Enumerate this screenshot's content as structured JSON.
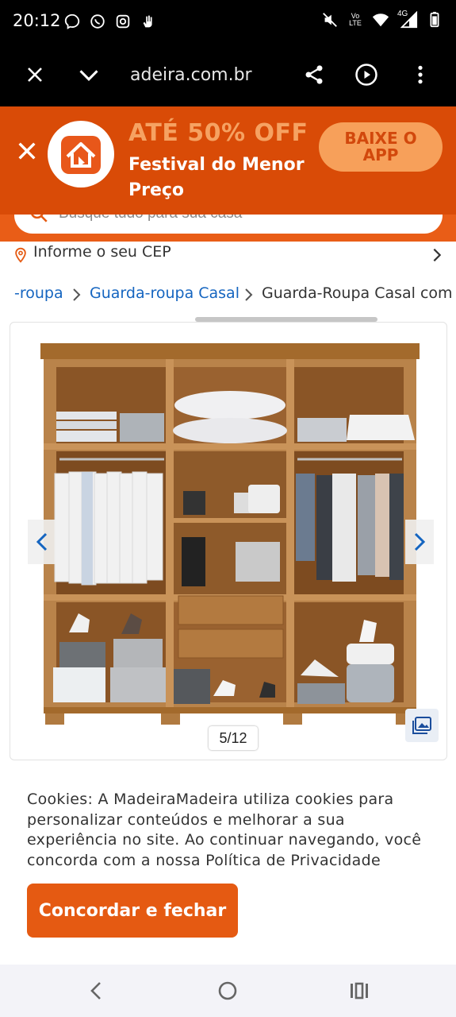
{
  "status_bar": {
    "time": "20:12",
    "left_icons": [
      "messenger-icon",
      "whatsapp-icon",
      "instagram-icon",
      "hand-icon"
    ],
    "right_icons": [
      "mute-icon",
      "volte-icon",
      "wifi-icon",
      "signal-4g-icon",
      "battery-icon"
    ],
    "network": "4G",
    "volte": "Vo LTE"
  },
  "browser": {
    "url": "adeira.com.br",
    "icons": [
      "close-icon",
      "chevron-down-icon",
      "share-icon",
      "play-icon",
      "more-vert-icon"
    ]
  },
  "app_banner": {
    "offer": "ATÉ 50% OFF",
    "subtitle": "Festival do Menor Preço",
    "button": "BAIXE O APP",
    "colors": {
      "bg": "#d94b07",
      "offer": "#f6a262",
      "button_bg": "#f7a05a",
      "button_text": "#d2480c"
    }
  },
  "search": {
    "placeholder": "Busque tudo para sua casa"
  },
  "cep": {
    "label": "Informe o seu CEP"
  },
  "breadcrumb": {
    "items": [
      "-roupa",
      "Guarda-roupa Casal",
      "Guarda-Roupa Casal com"
    ]
  },
  "gallery": {
    "counter": "5/12",
    "current": 5,
    "total": 12
  },
  "cookie": {
    "message": "Cookies: A MadeiraMadeira utiliza cookies para personalizar conteúdos e melhorar a sua experiência no site. Ao continuar navegando, você concorda com a nossa Política de Privacidade",
    "accept": "Concordar e fechar",
    "accent": "#e55a12"
  },
  "system_nav": {
    "icons": [
      "back-icon",
      "home-icon",
      "recents-icon"
    ]
  }
}
